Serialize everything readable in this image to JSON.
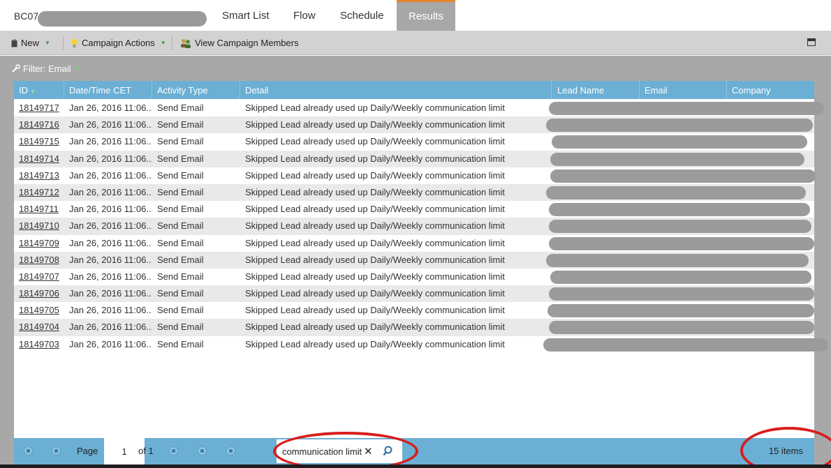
{
  "tabs": {
    "campaign_name": "BC07",
    "items": [
      {
        "label": "Smart List"
      },
      {
        "label": "Flow"
      },
      {
        "label": "Schedule"
      },
      {
        "label": "Results",
        "active": true
      }
    ]
  },
  "toolbar": {
    "new_label": "New",
    "actions_label": "Campaign Actions",
    "members_label": "View Campaign Members"
  },
  "filter": {
    "label": "Filter: Email"
  },
  "grid": {
    "columns": [
      "ID",
      "Date/Time CET",
      "Activity Type",
      "Detail",
      "Lead Name",
      "Email",
      "Company"
    ],
    "rows": [
      {
        "id": "18149717",
        "date": "Jan 26, 2016 11:06...",
        "type": "Send Email",
        "detail": "Skipped Lead already used up Daily/Weekly communication limit"
      },
      {
        "id": "18149716",
        "date": "Jan 26, 2016 11:06...",
        "type": "Send Email",
        "detail": "Skipped Lead already used up Daily/Weekly communication limit"
      },
      {
        "id": "18149715",
        "date": "Jan 26, 2016 11:06...",
        "type": "Send Email",
        "detail": "Skipped Lead already used up Daily/Weekly communication limit"
      },
      {
        "id": "18149714",
        "date": "Jan 26, 2016 11:06...",
        "type": "Send Email",
        "detail": "Skipped Lead already used up Daily/Weekly communication limit"
      },
      {
        "id": "18149713",
        "date": "Jan 26, 2016 11:06...",
        "type": "Send Email",
        "detail": "Skipped Lead already used up Daily/Weekly communication limit"
      },
      {
        "id": "18149712",
        "date": "Jan 26, 2016 11:06...",
        "type": "Send Email",
        "detail": "Skipped Lead already used up Daily/Weekly communication limit"
      },
      {
        "id": "18149711",
        "date": "Jan 26, 2016 11:06...",
        "type": "Send Email",
        "detail": "Skipped Lead already used up Daily/Weekly communication limit"
      },
      {
        "id": "18149710",
        "date": "Jan 26, 2016 11:06...",
        "type": "Send Email",
        "detail": "Skipped Lead already used up Daily/Weekly communication limit"
      },
      {
        "id": "18149709",
        "date": "Jan 26, 2016 11:06...",
        "type": "Send Email",
        "detail": "Skipped Lead already used up Daily/Weekly communication limit"
      },
      {
        "id": "18149708",
        "date": "Jan 26, 2016 11:06...",
        "type": "Send Email",
        "detail": "Skipped Lead already used up Daily/Weekly communication limit"
      },
      {
        "id": "18149707",
        "date": "Jan 26, 2016 11:06...",
        "type": "Send Email",
        "detail": "Skipped Lead already used up Daily/Weekly communication limit"
      },
      {
        "id": "18149706",
        "date": "Jan 26, 2016 11:06...",
        "type": "Send Email",
        "detail": "Skipped Lead already used up Daily/Weekly communication limit"
      },
      {
        "id": "18149705",
        "date": "Jan 26, 2016 11:06...",
        "type": "Send Email",
        "detail": "Skipped Lead already used up Daily/Weekly communication limit"
      },
      {
        "id": "18149704",
        "date": "Jan 26, 2016 11:06...",
        "type": "Send Email",
        "detail": "Skipped Lead already used up Daily/Weekly communication limit"
      },
      {
        "id": "18149703",
        "date": "Jan 26, 2016 11:06...",
        "type": "Send Email",
        "detail": "Skipped Lead already used up Daily/Weekly communication limit"
      }
    ]
  },
  "pager": {
    "page_label": "Page",
    "page_value": "1",
    "of_label": "of 1",
    "search_value": "communication limit",
    "items_label": "15 items"
  },
  "colors": {
    "header_blue": "#6bafd4",
    "tab_active": "#a7a7a7",
    "tab_accent": "#e7822f",
    "annotation_red": "#d81e1e",
    "redaction_gray": "#9b9b9b"
  }
}
